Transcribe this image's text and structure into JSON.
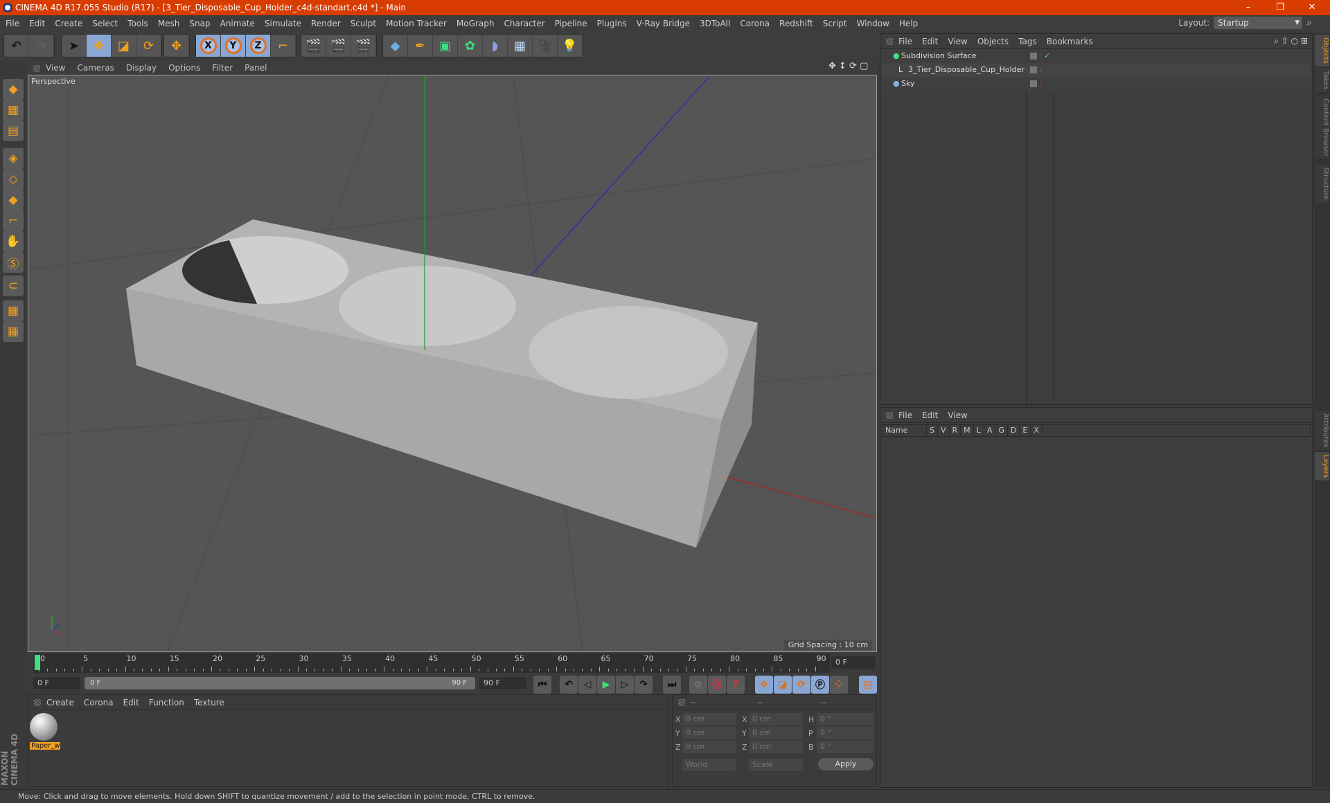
{
  "window": {
    "title": "CINEMA 4D R17.055 Studio (R17) - [3_Tier_Disposable_Cup_Holder_c4d-standart.c4d *] - Main",
    "controls": [
      "–",
      "❐",
      "✕"
    ],
    "accent": "#d83c00"
  },
  "menu": [
    "File",
    "Edit",
    "Create",
    "Select",
    "Tools",
    "Mesh",
    "Snap",
    "Animate",
    "Simulate",
    "Render",
    "Sculpt",
    "Motion Tracker",
    "MoGraph",
    "Character",
    "Pipeline",
    "Plugins",
    "V-Ray Bridge",
    "3DToAll",
    "Corona",
    "Redshift",
    "Script",
    "Window",
    "Help"
  ],
  "layout": {
    "label": "Layout:",
    "value": "Startup"
  },
  "toolbar": {
    "icons": [
      "undo-icon",
      "redo-icon",
      "select-icon",
      "move-icon",
      "scale-icon",
      "rotate-icon",
      "transform-icon",
      "x-axis-icon",
      "y-axis-icon",
      "z-axis-icon",
      "coordinate-system-icon",
      "render-view-icon",
      "render-picture-viewer-icon",
      "render-settings-icon",
      "cube-icon",
      "pen-icon",
      "subdivision-icon",
      "cloner-icon",
      "deformer-icon",
      "floor-icon",
      "camera-icon",
      "light-icon"
    ],
    "axis_labels": [
      "X",
      "Y",
      "Z"
    ]
  },
  "left_tools": [
    "model-mode-icon",
    "texture-mode-icon",
    "workplane-icon",
    "points-mode-icon",
    "edges-mode-icon",
    "polygons-mode-icon",
    "axis-icon",
    "tweak-icon",
    "snap-icon",
    "magnet-icon",
    "lock-grid-icon",
    "grid-icon"
  ],
  "viewport": {
    "menu": [
      "View",
      "Cameras",
      "Display",
      "Options",
      "Filter",
      "Panel"
    ],
    "camera": "Perspective",
    "grid_spacing": "Grid Spacing : 10 cm"
  },
  "timeline": {
    "ticks": [
      "0",
      "5",
      "10",
      "15",
      "20",
      "25",
      "30",
      "35",
      "40",
      "45",
      "50",
      "55",
      "60",
      "65",
      "70",
      "75",
      "80",
      "85",
      "90"
    ],
    "current_frame": "0 F",
    "start": "0 F",
    "range_start": "0 F",
    "range_end": "90 F",
    "end": "90 F"
  },
  "materials": {
    "menu": [
      "Create",
      "Corona",
      "Edit",
      "Function",
      "Texture"
    ],
    "items": [
      {
        "name": "Paper_w"
      }
    ]
  },
  "coordinates": {
    "headers": [
      "--",
      "--",
      "--"
    ],
    "rows": [
      {
        "a": "X",
        "av": "0 cm",
        "b": "X",
        "bv": "0 cm",
        "c": "H",
        "cv": "0 °"
      },
      {
        "a": "Y",
        "av": "0 cm",
        "b": "Y",
        "bv": "0 cm",
        "c": "P",
        "cv": "0 °"
      },
      {
        "a": "Z",
        "av": "0 cm",
        "b": "Z",
        "bv": "0 cm",
        "c": "B",
        "cv": "0 °"
      }
    ],
    "mode": "World",
    "scale": "Scale",
    "apply": "Apply"
  },
  "objects": {
    "menu": [
      "File",
      "Edit",
      "View",
      "Objects",
      "Tags",
      "Bookmarks"
    ],
    "items": [
      {
        "name": "Subdivision Surface",
        "icon": "subdivision-icon",
        "check": "✓"
      },
      {
        "name": "3_Tier_Disposable_Cup_Holder",
        "icon": "null-object-icon"
      },
      {
        "name": "Sky",
        "icon": "sky-icon"
      }
    ]
  },
  "layers": {
    "menu": [
      "File",
      "Edit",
      "View"
    ],
    "columns": [
      "Name",
      "S",
      "V",
      "R",
      "M",
      "L",
      "A",
      "G",
      "D",
      "E",
      "X"
    ]
  },
  "right_tabs": [
    "Objects",
    "Takes",
    "Content Browser",
    "Structure",
    "Attributes",
    "Layers"
  ],
  "status": "Move: Click and drag to move elements. Hold down SHIFT to quantize movement / add to the selection in point mode, CTRL to remove.",
  "branding": "MAXON CINEMA 4D"
}
